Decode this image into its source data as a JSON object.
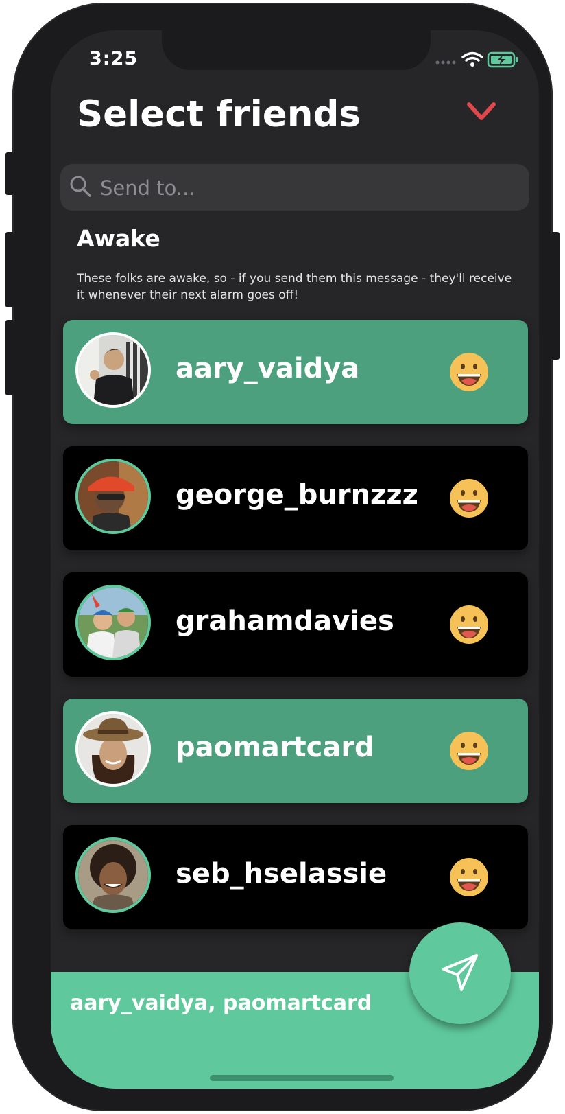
{
  "status_bar": {
    "time": "3:25"
  },
  "header": {
    "title": "Select friends",
    "close_icon": "chevron-down-icon"
  },
  "search": {
    "placeholder": "Send to...",
    "value": ""
  },
  "section": {
    "title": "Awake",
    "description": "These folks are awake, so - if you send them this message - they'll receive it whenever their next alarm goes off!"
  },
  "friends": [
    {
      "username": "aary_vaidya",
      "selected": true,
      "status_icon": "grinning-face-emoji"
    },
    {
      "username": "george_burnzzz",
      "selected": false,
      "status_icon": "grinning-face-emoji"
    },
    {
      "username": "grahamdavies",
      "selected": false,
      "status_icon": "grinning-face-emoji"
    },
    {
      "username": "paomartcard",
      "selected": true,
      "status_icon": "grinning-face-emoji"
    },
    {
      "username": "seb_hselassie",
      "selected": false,
      "status_icon": "grinning-face-emoji"
    }
  ],
  "footer": {
    "recipients": "aary_vaidya, paomartcard",
    "send_icon": "paper-plane-icon"
  },
  "colors": {
    "selected_card": "#4ca07e",
    "unselected_card": "#000000",
    "accent_green": "#5fc99d",
    "close_red": "#e0484c",
    "background": "#262628"
  }
}
